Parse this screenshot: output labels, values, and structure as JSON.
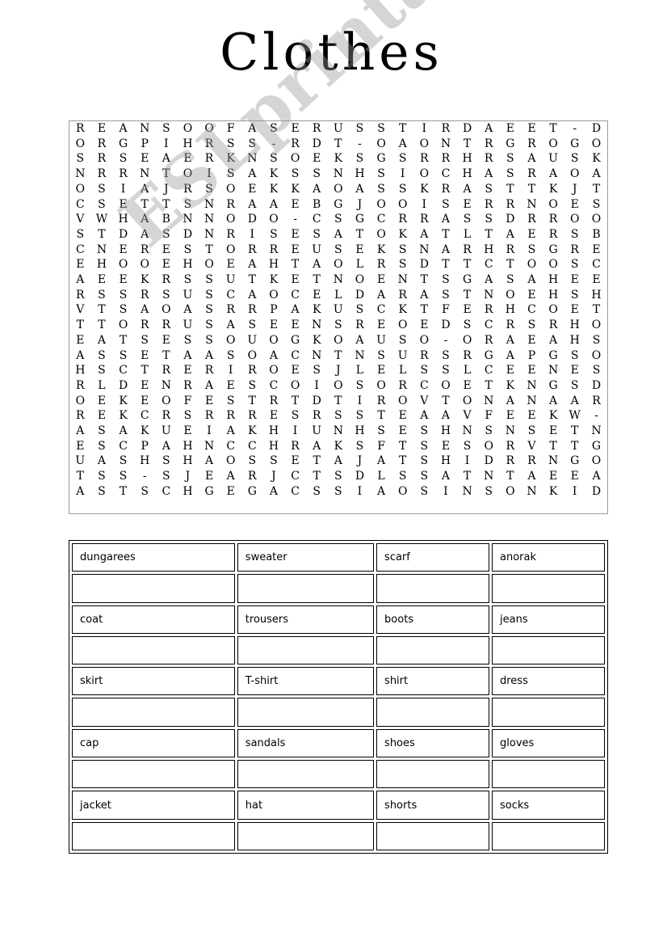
{
  "page": {
    "title": "Clothes",
    "watermark": "ESLprintables.com",
    "background_color": "#ffffff",
    "text_color": "#000000"
  },
  "puzzle": {
    "type": "word-search",
    "rows": 25,
    "columns": 25,
    "border_color": "#9a9a9a",
    "grid": [
      [
        "R",
        "E",
        "A",
        "N",
        "S",
        "O",
        "O",
        "F",
        "A",
        "S",
        "E",
        "R",
        "U",
        "S",
        "S",
        "T",
        "I",
        "R",
        "D",
        "A",
        "E",
        "E",
        "T",
        "-",
        "D"
      ],
      [
        "O",
        "R",
        "G",
        "P",
        "I",
        "H",
        "R",
        "S",
        "S",
        "-",
        "R",
        "D",
        "T",
        "-",
        "O",
        "A",
        "O",
        "N",
        "T",
        "R",
        "G",
        "R",
        "O",
        "G",
        "O"
      ],
      [
        "S",
        "R",
        "S",
        "E",
        "A",
        "E",
        "R",
        "K",
        "N",
        "S",
        "O",
        "E",
        "K",
        "S",
        "G",
        "S",
        "R",
        "R",
        "H",
        "R",
        "S",
        "A",
        "U",
        "S",
        "K"
      ],
      [
        "N",
        "R",
        "R",
        "N",
        "T",
        "O",
        "I",
        "S",
        "A",
        "K",
        "S",
        "S",
        "N",
        "H",
        "S",
        "I",
        "O",
        "C",
        "H",
        "A",
        "S",
        "R",
        "A",
        "O",
        "A"
      ],
      [
        "O",
        "S",
        "I",
        "A",
        "J",
        "R",
        "S",
        "O",
        "E",
        "K",
        "K",
        "A",
        "O",
        "A",
        "S",
        "S",
        "K",
        "R",
        "A",
        "S",
        "T",
        "T",
        "K",
        "J",
        "T"
      ],
      [
        "C",
        "S",
        "E",
        "T",
        "T",
        "S",
        "N",
        "R",
        "A",
        "A",
        "E",
        "B",
        "G",
        "J",
        "O",
        "O",
        "I",
        "S",
        "E",
        "R",
        "R",
        "N",
        "O",
        "E",
        "S"
      ],
      [
        "V",
        "W",
        "H",
        "A",
        "B",
        "N",
        "N",
        "O",
        "D",
        "O",
        "-",
        "C",
        "S",
        "G",
        "C",
        "R",
        "R",
        "A",
        "S",
        "S",
        "D",
        "R",
        "R",
        "O",
        "O"
      ],
      [
        "S",
        "T",
        "D",
        "A",
        "S",
        "D",
        "N",
        "R",
        "I",
        "S",
        "E",
        "S",
        "A",
        "T",
        "O",
        "K",
        "A",
        "T",
        "L",
        "T",
        "A",
        "E",
        "R",
        "S",
        "B"
      ],
      [
        "C",
        "N",
        "E",
        "R",
        "E",
        "S",
        "T",
        "O",
        "R",
        "R",
        "E",
        "U",
        "S",
        "E",
        "K",
        "S",
        "N",
        "A",
        "R",
        "H",
        "R",
        "S",
        "G",
        "R",
        "E"
      ],
      [
        "E",
        "H",
        "O",
        "O",
        "E",
        "H",
        "O",
        "E",
        "A",
        "H",
        "T",
        "A",
        "O",
        "L",
        "R",
        "S",
        "D",
        "T",
        "T",
        "C",
        "T",
        "O",
        "O",
        "S",
        "C"
      ],
      [
        "A",
        "E",
        "E",
        "K",
        "R",
        "S",
        "S",
        "U",
        "T",
        "K",
        "E",
        "T",
        "N",
        "O",
        "E",
        "N",
        "T",
        "S",
        "G",
        "A",
        "S",
        "A",
        "H",
        "E",
        "E"
      ],
      [
        "R",
        "S",
        "S",
        "R",
        "S",
        "U",
        "S",
        "C",
        "A",
        "O",
        "C",
        "E",
        "L",
        "D",
        "A",
        "R",
        "A",
        "S",
        "T",
        "N",
        "O",
        "E",
        "H",
        "S",
        "H"
      ],
      [
        "V",
        "T",
        "S",
        "A",
        "O",
        "A",
        "S",
        "R",
        "R",
        "P",
        "A",
        "K",
        "U",
        "S",
        "C",
        "K",
        "T",
        "F",
        "E",
        "R",
        "H",
        "C",
        "O",
        "E",
        "T"
      ],
      [
        "T",
        "T",
        "O",
        "R",
        "R",
        "U",
        "S",
        "A",
        "S",
        "E",
        "E",
        "N",
        "S",
        "R",
        "E",
        "O",
        "E",
        "D",
        "S",
        "C",
        "R",
        "S",
        "R",
        "H",
        "O"
      ],
      [
        "E",
        "A",
        "T",
        "S",
        "E",
        "S",
        "S",
        "O",
        "U",
        "O",
        "G",
        "K",
        "O",
        "A",
        "U",
        "S",
        "O",
        "-",
        "O",
        "R",
        "A",
        "E",
        "A",
        "H",
        "S"
      ],
      [
        "A",
        "S",
        "S",
        "E",
        "T",
        "A",
        "A",
        "S",
        "O",
        "A",
        "C",
        "N",
        "T",
        "N",
        "S",
        "U",
        "R",
        "S",
        "R",
        "G",
        "A",
        "P",
        "G",
        "S",
        "O"
      ],
      [
        "H",
        "S",
        "C",
        "T",
        "R",
        "E",
        "R",
        "I",
        "R",
        "O",
        "E",
        "S",
        "J",
        "L",
        "E",
        "L",
        "S",
        "S",
        "L",
        "C",
        "E",
        "E",
        "N",
        "E",
        "S"
      ],
      [
        "R",
        "L",
        "D",
        "E",
        "N",
        "R",
        "A",
        "E",
        "S",
        "C",
        "O",
        "I",
        "O",
        "S",
        "O",
        "R",
        "C",
        "O",
        "E",
        "T",
        "K",
        "N",
        "G",
        "S",
        "D"
      ],
      [
        "O",
        "E",
        "K",
        "E",
        "O",
        "F",
        "E",
        "S",
        "T",
        "R",
        "T",
        "D",
        "T",
        "I",
        "R",
        "O",
        "V",
        "T",
        "O",
        "N",
        "A",
        "N",
        "A",
        "A",
        "R"
      ],
      [
        "R",
        "E",
        "K",
        "C",
        "R",
        "S",
        "R",
        "R",
        "R",
        "E",
        "S",
        "R",
        "S",
        "S",
        "T",
        "E",
        "A",
        "A",
        "V",
        "F",
        "E",
        "E",
        "K",
        "W",
        "-"
      ],
      [
        "A",
        "S",
        "A",
        "K",
        "U",
        "E",
        "I",
        "A",
        "K",
        "H",
        "I",
        "U",
        "N",
        "H",
        "S",
        "E",
        "S",
        "H",
        "N",
        "S",
        "N",
        "S",
        "E",
        "T",
        "N"
      ],
      [
        "E",
        "S",
        "C",
        "P",
        "A",
        "H",
        "N",
        "C",
        "C",
        "H",
        "R",
        "A",
        "K",
        "S",
        "F",
        "T",
        "S",
        "E",
        "S",
        "O",
        "R",
        "V",
        "T",
        "T",
        "G"
      ],
      [
        "U",
        "A",
        "S",
        "H",
        "S",
        "H",
        "A",
        "O",
        "S",
        "S",
        "E",
        "T",
        "A",
        "J",
        "A",
        "T",
        "S",
        "H",
        "I",
        "D",
        "R",
        "R",
        "N",
        "G",
        "O"
      ],
      [
        "T",
        "S",
        "S",
        "-",
        "S",
        "J",
        "E",
        "A",
        "R",
        "J",
        "C",
        "T",
        "S",
        "D",
        "L",
        "S",
        "S",
        "A",
        "T",
        "N",
        "T",
        "A",
        "E",
        "E",
        "A"
      ],
      [
        "A",
        "S",
        "T",
        "S",
        "C",
        "H",
        "G",
        "E",
        "G",
        "A",
        "C",
        "S",
        "S",
        "I",
        "A",
        "O",
        "S",
        "I",
        "N",
        "S",
        "O",
        "N",
        "K",
        "I",
        "D"
      ]
    ]
  },
  "word_list": {
    "rows": [
      [
        "dungarees",
        "sweater",
        "scarf",
        "anorak"
      ],
      [
        "",
        "",
        "",
        ""
      ],
      [
        "coat",
        "trousers",
        "boots",
        "jeans"
      ],
      [
        "",
        "",
        "",
        ""
      ],
      [
        "skirt",
        "T-shirt",
        "shirt",
        "dress"
      ],
      [
        "",
        "",
        "",
        ""
      ],
      [
        "cap",
        "sandals",
        "shoes",
        "gloves"
      ],
      [
        "",
        "",
        "",
        ""
      ],
      [
        "jacket",
        "hat",
        "shorts",
        "socks"
      ],
      [
        "",
        "",
        "",
        ""
      ]
    ],
    "words": [
      "dungarees",
      "sweater",
      "scarf",
      "anorak",
      "coat",
      "trousers",
      "boots",
      "jeans",
      "skirt",
      "T-shirt",
      "shirt",
      "dress",
      "cap",
      "sandals",
      "shoes",
      "gloves",
      "jacket",
      "hat",
      "shorts",
      "socks"
    ],
    "border_color": "#000000"
  }
}
